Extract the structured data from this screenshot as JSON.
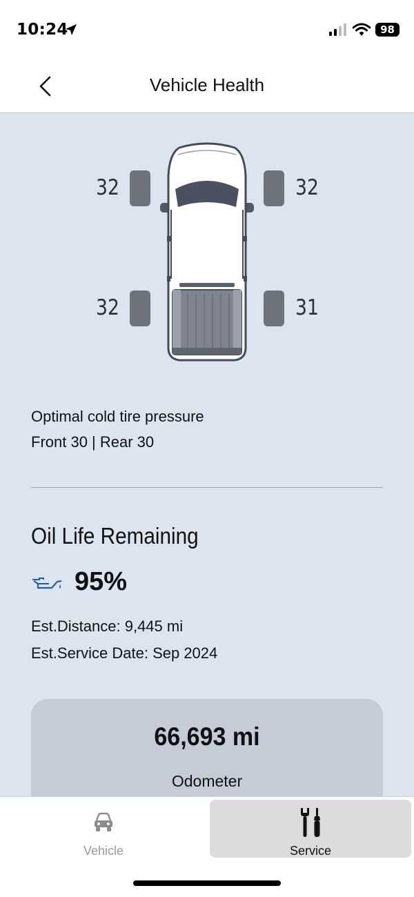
{
  "status_bar": {
    "time": "10:24",
    "battery": "98",
    "icons": [
      "location-arrow-icon",
      "cellular-signal-icon",
      "wifi-icon",
      "battery-icon"
    ]
  },
  "header": {
    "title": "Vehicle Health",
    "back_icon": "chevron-left-icon"
  },
  "tires": {
    "front_left": "32",
    "front_right": "32",
    "rear_left": "32",
    "rear_right": "31"
  },
  "tire_info": {
    "line1": "Optimal cold tire pressure",
    "line2": "Front 30 | Rear 30"
  },
  "oil": {
    "title": "Oil Life Remaining",
    "percent": "95%",
    "icon": "oil-can-icon",
    "est_distance": "Est.Distance: 9,445 mi",
    "est_service_date": "Est.Service Date: Sep 2024"
  },
  "odometer": {
    "value": "66,693 mi",
    "label": "Odometer"
  },
  "tab_bar": {
    "tabs": [
      {
        "label": "Vehicle",
        "icon": "car-icon",
        "selected": false
      },
      {
        "label": "Service",
        "icon": "wrench-screwdriver-icon",
        "selected": true
      }
    ]
  },
  "colors": {
    "background": "#dbe4ef",
    "card": "#c5ccd8",
    "tire": "#6e737b",
    "oil_icon": "#1f5fa8",
    "selected_tab": "#dcdcdf"
  }
}
